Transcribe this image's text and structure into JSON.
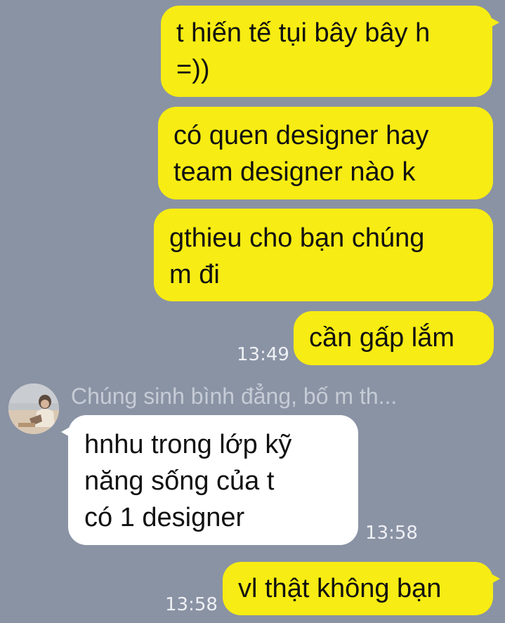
{
  "messages": [
    {
      "id": "m1",
      "lines": [
        "t hiến tế tụi bây bây h",
        "=))"
      ]
    },
    {
      "id": "m2",
      "lines": [
        "có quen designer hay",
        "team designer nào k"
      ]
    },
    {
      "id": "m3",
      "lines": [
        "gthieu cho bạn chúng",
        "m đi"
      ]
    },
    {
      "id": "m4",
      "lines": [
        "cần gấp lắm"
      ],
      "time": "13:49"
    },
    {
      "id": "m5",
      "sender": "Chúng sinh bình đẳng, bố m th...",
      "lines": [
        "hnhu trong lớp kỹ",
        "năng sống của t",
        "có 1 designer"
      ],
      "time": "13:58"
    },
    {
      "id": "m6",
      "lines": [
        "vl thật không bạn"
      ],
      "time": "13:58"
    }
  ],
  "colors": {
    "background": "#8a93a4",
    "outgoing_bubble": "#f7ec13",
    "incoming_bubble": "#ffffff"
  },
  "icons": {
    "avatar": "contact-avatar-photo"
  }
}
